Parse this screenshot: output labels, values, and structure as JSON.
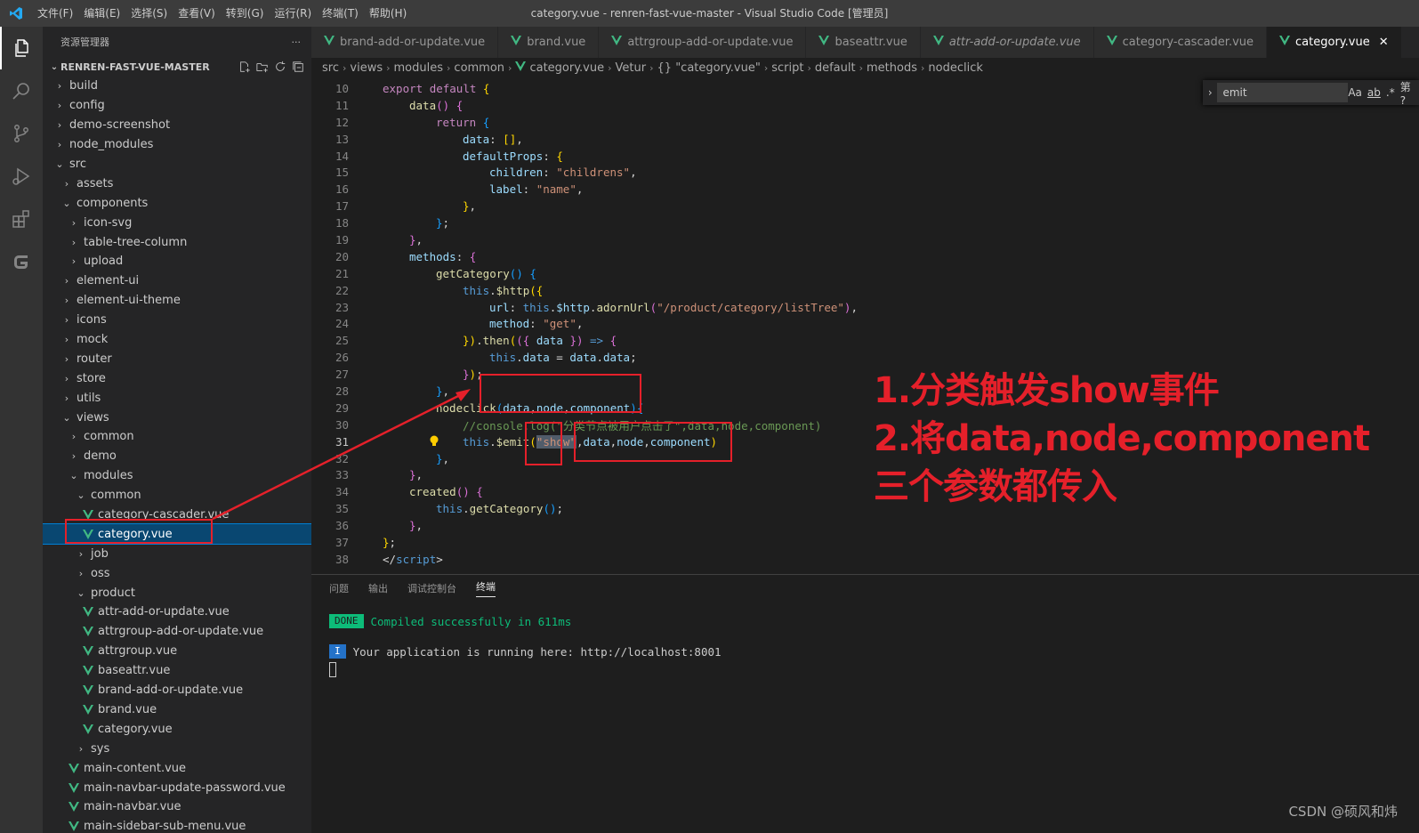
{
  "titlebar": {
    "menus": [
      "文件(F)",
      "编辑(E)",
      "选择(S)",
      "查看(V)",
      "转到(G)",
      "运行(R)",
      "终端(T)",
      "帮助(H)"
    ],
    "title": "category.vue - renren-fast-vue-master - Visual Studio Code [管理员]"
  },
  "sidebar": {
    "title": "资源管理器",
    "more": "···",
    "root": "RENREN-FAST-VUE-MASTER",
    "items": [
      {
        "label": "build",
        "depth": 0,
        "kind": "folder",
        "open": false
      },
      {
        "label": "config",
        "depth": 0,
        "kind": "folder",
        "open": false
      },
      {
        "label": "demo-screenshot",
        "depth": 0,
        "kind": "folder",
        "open": false
      },
      {
        "label": "node_modules",
        "depth": 0,
        "kind": "folder",
        "open": false
      },
      {
        "label": "src",
        "depth": 0,
        "kind": "folder",
        "open": true
      },
      {
        "label": "assets",
        "depth": 1,
        "kind": "folder",
        "open": false
      },
      {
        "label": "components",
        "depth": 1,
        "kind": "folder",
        "open": true
      },
      {
        "label": "icon-svg",
        "depth": 2,
        "kind": "folder",
        "open": false
      },
      {
        "label": "table-tree-column",
        "depth": 2,
        "kind": "folder",
        "open": false
      },
      {
        "label": "upload",
        "depth": 2,
        "kind": "folder",
        "open": false
      },
      {
        "label": "element-ui",
        "depth": 1,
        "kind": "folder",
        "open": false
      },
      {
        "label": "element-ui-theme",
        "depth": 1,
        "kind": "folder",
        "open": false
      },
      {
        "label": "icons",
        "depth": 1,
        "kind": "folder",
        "open": false
      },
      {
        "label": "mock",
        "depth": 1,
        "kind": "folder",
        "open": false
      },
      {
        "label": "router",
        "depth": 1,
        "kind": "folder",
        "open": false
      },
      {
        "label": "store",
        "depth": 1,
        "kind": "folder",
        "open": false
      },
      {
        "label": "utils",
        "depth": 1,
        "kind": "folder",
        "open": false
      },
      {
        "label": "views",
        "depth": 1,
        "kind": "folder",
        "open": true
      },
      {
        "label": "common",
        "depth": 2,
        "kind": "folder",
        "open": false
      },
      {
        "label": "demo",
        "depth": 2,
        "kind": "folder",
        "open": false
      },
      {
        "label": "modules",
        "depth": 2,
        "kind": "folder",
        "open": true
      },
      {
        "label": "common",
        "depth": 3,
        "kind": "folder",
        "open": true
      },
      {
        "label": "category-cascader.vue",
        "depth": 4,
        "kind": "vue"
      },
      {
        "label": "category.vue",
        "depth": 4,
        "kind": "vue",
        "selected": true
      },
      {
        "label": "job",
        "depth": 3,
        "kind": "folder",
        "open": false
      },
      {
        "label": "oss",
        "depth": 3,
        "kind": "folder",
        "open": false
      },
      {
        "label": "product",
        "depth": 3,
        "kind": "folder",
        "open": true
      },
      {
        "label": "attr-add-or-update.vue",
        "depth": 4,
        "kind": "vue"
      },
      {
        "label": "attrgroup-add-or-update.vue",
        "depth": 4,
        "kind": "vue"
      },
      {
        "label": "attrgroup.vue",
        "depth": 4,
        "kind": "vue"
      },
      {
        "label": "baseattr.vue",
        "depth": 4,
        "kind": "vue"
      },
      {
        "label": "brand-add-or-update.vue",
        "depth": 4,
        "kind": "vue"
      },
      {
        "label": "brand.vue",
        "depth": 4,
        "kind": "vue"
      },
      {
        "label": "category.vue",
        "depth": 4,
        "kind": "vue"
      },
      {
        "label": "sys",
        "depth": 3,
        "kind": "folder",
        "open": false
      },
      {
        "label": "main-content.vue",
        "depth": 2,
        "kind": "vue"
      },
      {
        "label": "main-navbar-update-password.vue",
        "depth": 2,
        "kind": "vue"
      },
      {
        "label": "main-navbar.vue",
        "depth": 2,
        "kind": "vue"
      },
      {
        "label": "main-sidebar-sub-menu.vue",
        "depth": 2,
        "kind": "vue"
      }
    ]
  },
  "tabs": [
    {
      "label": "brand-add-or-update.vue"
    },
    {
      "label": "brand.vue"
    },
    {
      "label": "attrgroup-add-or-update.vue"
    },
    {
      "label": "baseattr.vue"
    },
    {
      "label": "attr-add-or-update.vue",
      "italic": true
    },
    {
      "label": "category-cascader.vue"
    },
    {
      "label": "category.vue",
      "active": true,
      "close": "✕"
    }
  ],
  "breadcrumb": [
    "src",
    "views",
    "modules",
    "common",
    "category.vue",
    "Vetur",
    "{} \"category.vue\"",
    "script",
    "default",
    "methods",
    "nodeclick"
  ],
  "find": {
    "value": "emit",
    "opt_case": "Aa",
    "opt_word": "ab",
    "opt_regex": ".*",
    "result": "第 ?"
  },
  "editor": {
    "current_line": 31,
    "lines": [
      {
        "n": 10,
        "ind": 0,
        "tok": [
          [
            "kw2",
            "export "
          ],
          [
            "kw2",
            "default "
          ],
          [
            "br1",
            "{"
          ]
        ]
      },
      {
        "n": 11,
        "ind": 1,
        "tok": [
          [
            "fn",
            "data"
          ],
          [
            "br2",
            "() "
          ],
          [
            "br2",
            "{"
          ]
        ]
      },
      {
        "n": 12,
        "ind": 2,
        "tok": [
          [
            "kw2",
            "return "
          ],
          [
            "br3",
            "{"
          ]
        ]
      },
      {
        "n": 13,
        "ind": 3,
        "tok": [
          [
            "prop",
            "data"
          ],
          [
            "pun",
            ": "
          ],
          [
            "br1",
            "[]"
          ],
          [
            "pun",
            ","
          ]
        ]
      },
      {
        "n": 14,
        "ind": 3,
        "tok": [
          [
            "prop",
            "defaultProps"
          ],
          [
            "pun",
            ": "
          ],
          [
            "br1",
            "{"
          ]
        ]
      },
      {
        "n": 15,
        "ind": 4,
        "tok": [
          [
            "prop",
            "children"
          ],
          [
            "pun",
            ": "
          ],
          [
            "str",
            "\"childrens\""
          ],
          [
            "pun",
            ","
          ]
        ]
      },
      {
        "n": 16,
        "ind": 4,
        "tok": [
          [
            "prop",
            "label"
          ],
          [
            "pun",
            ": "
          ],
          [
            "str",
            "\"name\""
          ],
          [
            "pun",
            ","
          ]
        ]
      },
      {
        "n": 17,
        "ind": 3,
        "tok": [
          [
            "br1",
            "}"
          ],
          [
            "pun",
            ","
          ]
        ]
      },
      {
        "n": 18,
        "ind": 2,
        "tok": [
          [
            "br3",
            "}"
          ],
          [
            "pun",
            ";"
          ]
        ]
      },
      {
        "n": 19,
        "ind": 1,
        "tok": [
          [
            "br2",
            "}"
          ],
          [
            "pun",
            ","
          ]
        ]
      },
      {
        "n": 20,
        "ind": 1,
        "tok": [
          [
            "prop",
            "methods"
          ],
          [
            "pun",
            ": "
          ],
          [
            "br2",
            "{"
          ]
        ]
      },
      {
        "n": 21,
        "ind": 2,
        "tok": [
          [
            "fn",
            "getCategory"
          ],
          [
            "br3",
            "() "
          ],
          [
            "br3",
            "{"
          ]
        ]
      },
      {
        "n": 22,
        "ind": 3,
        "tok": [
          [
            "kw",
            "this"
          ],
          [
            "pun",
            "."
          ],
          [
            "fn",
            "$http"
          ],
          [
            "br1",
            "({"
          ]
        ]
      },
      {
        "n": 23,
        "ind": 4,
        "tok": [
          [
            "prop",
            "url"
          ],
          [
            "pun",
            ": "
          ],
          [
            "kw",
            "this"
          ],
          [
            "pun",
            "."
          ],
          [
            "prop",
            "$http"
          ],
          [
            "pun",
            "."
          ],
          [
            "fn",
            "adornUrl"
          ],
          [
            "br2",
            "("
          ],
          [
            "str",
            "\"/product/category/listTree\""
          ],
          [
            "br2",
            ")"
          ],
          [
            "pun",
            ","
          ]
        ]
      },
      {
        "n": 24,
        "ind": 4,
        "tok": [
          [
            "prop",
            "method"
          ],
          [
            "pun",
            ": "
          ],
          [
            "str",
            "\"get\""
          ],
          [
            "pun",
            ","
          ]
        ]
      },
      {
        "n": 25,
        "ind": 3,
        "tok": [
          [
            "br1",
            "})"
          ],
          [
            "pun",
            "."
          ],
          [
            "fn",
            "then"
          ],
          [
            "br1",
            "("
          ],
          [
            "br2",
            "({ "
          ],
          [
            "prop",
            "data "
          ],
          [
            "br2",
            "}) "
          ],
          [
            "kw",
            "=> "
          ],
          [
            "br2",
            "{"
          ]
        ]
      },
      {
        "n": 26,
        "ind": 4,
        "tok": [
          [
            "kw",
            "this"
          ],
          [
            "pun",
            "."
          ],
          [
            "prop",
            "data"
          ],
          [
            "pun",
            " = "
          ],
          [
            "prop",
            "data"
          ],
          [
            "pun",
            "."
          ],
          [
            "prop",
            "data"
          ],
          [
            "pun",
            ";"
          ]
        ]
      },
      {
        "n": 27,
        "ind": 3,
        "tok": [
          [
            "br2",
            "}"
          ],
          [
            "br1",
            ")"
          ],
          [
            "pun",
            ";"
          ]
        ]
      },
      {
        "n": 28,
        "ind": 2,
        "tok": [
          [
            "br3",
            "}"
          ],
          [
            "pun",
            ","
          ]
        ]
      },
      {
        "n": 29,
        "ind": 2,
        "tok": [
          [
            "fn",
            "nodeclick"
          ],
          [
            "br3",
            "("
          ],
          [
            "prop",
            "data"
          ],
          [
            "pun",
            ","
          ],
          [
            "prop",
            "node"
          ],
          [
            "pun",
            ","
          ],
          [
            "prop",
            "component"
          ],
          [
            "br3",
            ")"
          ],
          [
            "br3",
            "{"
          ]
        ]
      },
      {
        "n": 30,
        "ind": 3,
        "tok": [
          [
            "cmt",
            "//console.log(\"分类节点被用户点击了\",data,node,component)"
          ]
        ]
      },
      {
        "n": 31,
        "ind": 3,
        "tok": [
          [
            "kw",
            "this"
          ],
          [
            "pun",
            "."
          ],
          [
            "fn",
            "$emit"
          ],
          [
            "br1",
            "("
          ],
          [
            "str",
            "\"show\""
          ],
          [
            "pun",
            ","
          ],
          [
            "prop",
            "data"
          ],
          [
            "pun",
            ","
          ],
          [
            "prop",
            "node"
          ],
          [
            "pun",
            ","
          ],
          [
            "prop",
            "component"
          ],
          [
            "br1",
            ")"
          ]
        ]
      },
      {
        "n": 32,
        "ind": 2,
        "tok": [
          [
            "br3",
            "}"
          ],
          [
            "pun",
            ","
          ]
        ]
      },
      {
        "n": 33,
        "ind": 1,
        "tok": [
          [
            "br2",
            "}"
          ],
          [
            "pun",
            ","
          ]
        ]
      },
      {
        "n": 34,
        "ind": 1,
        "tok": [
          [
            "fn",
            "created"
          ],
          [
            "br2",
            "() "
          ],
          [
            "br2",
            "{"
          ]
        ]
      },
      {
        "n": 35,
        "ind": 2,
        "tok": [
          [
            "kw",
            "this"
          ],
          [
            "pun",
            "."
          ],
          [
            "fn",
            "getCategory"
          ],
          [
            "br3",
            "()"
          ],
          [
            "pun",
            ";"
          ]
        ]
      },
      {
        "n": 36,
        "ind": 1,
        "tok": [
          [
            "br2",
            "}"
          ],
          [
            "pun",
            ","
          ]
        ]
      },
      {
        "n": 37,
        "ind": 0,
        "tok": [
          [
            "br1",
            "}"
          ],
          [
            "pun",
            ";"
          ]
        ]
      },
      {
        "n": 38,
        "ind": 0,
        "tok": [
          [
            "pun",
            "</"
          ],
          [
            "kw",
            "script"
          ],
          [
            "pun",
            ">"
          ]
        ]
      }
    ]
  },
  "panel": {
    "tabs": [
      "问题",
      "输出",
      "调试控制台",
      "终端"
    ],
    "active_tab": "终端",
    "done_badge": "DONE",
    "done_text": "Compiled successfully in 611ms",
    "info_badge": "I",
    "info_text": "Your application is running here: http://localhost:8001"
  },
  "annotation": {
    "line1": "1.分类触发show事件",
    "line2": "2.将data,node,component",
    "line3": "三个参数都传入",
    "color": "#e5202a"
  },
  "watermark": "CSDN @硕风和炜",
  "colors": {
    "accent": "#007acc",
    "vue_green": "#41b883",
    "selection": "#094771"
  }
}
